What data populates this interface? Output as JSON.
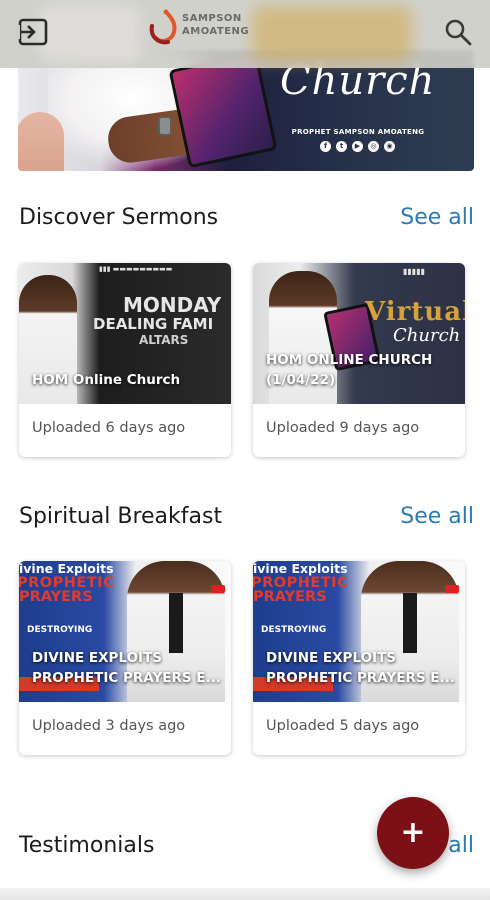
{
  "header": {
    "logo_text_line1": "SAMPSON",
    "logo_text_line2": "AMOATENG",
    "icons": {
      "menu": "exit-to-app-icon",
      "search": "search-icon"
    }
  },
  "banner": {
    "title": "Church",
    "subtitle": "PROPHET SAMPSON AMOATENG",
    "social_icons": [
      "facebook-icon",
      "twitter-icon",
      "youtube-icon",
      "instagram-icon",
      "web-icon"
    ]
  },
  "sections": [
    {
      "title": "Discover Sermons",
      "see_all": "See all",
      "cards": [
        {
          "thumb_title": "HOM Online Church",
          "meta": "Uploaded 6 days ago",
          "overlay": {
            "line1": "MONDAY",
            "line2": "DEALING FAMI",
            "line3": "ALTARS"
          }
        },
        {
          "thumb_title": "HOM ONLINE CHURCH (1/04/22)",
          "meta": "Uploaded 9 days ago",
          "overlay": {
            "line1": "Virtual",
            "line2": "Church"
          }
        }
      ]
    },
    {
      "title": "Spiritual Breakfast",
      "see_all": "See all",
      "cards": [
        {
          "thumb_title": "DIVINE EXPLOITS PROPHETIC PRAYERS E...",
          "meta": "Uploaded 3 days ago",
          "overlay": {
            "line1": "ivine Exploits",
            "line2": "PROPHETIC",
            "line3": "PRAYERS",
            "line4": "DESTROYING"
          }
        },
        {
          "thumb_title": "DIVINE EXPLOITS PROPHETIC PRAYERS E...",
          "meta": "Uploaded 5 days ago",
          "overlay": {
            "line1": "ivine Exploits",
            "line2": "PROPHETIC",
            "line3": "PRAYERS",
            "line4": "DESTROYING"
          }
        }
      ]
    },
    {
      "title": "Testimonials",
      "see_all": "all"
    }
  ],
  "fab": {
    "label": "+"
  },
  "colors": {
    "accent": "#2a7ab5",
    "fab": "#7d0f16"
  }
}
